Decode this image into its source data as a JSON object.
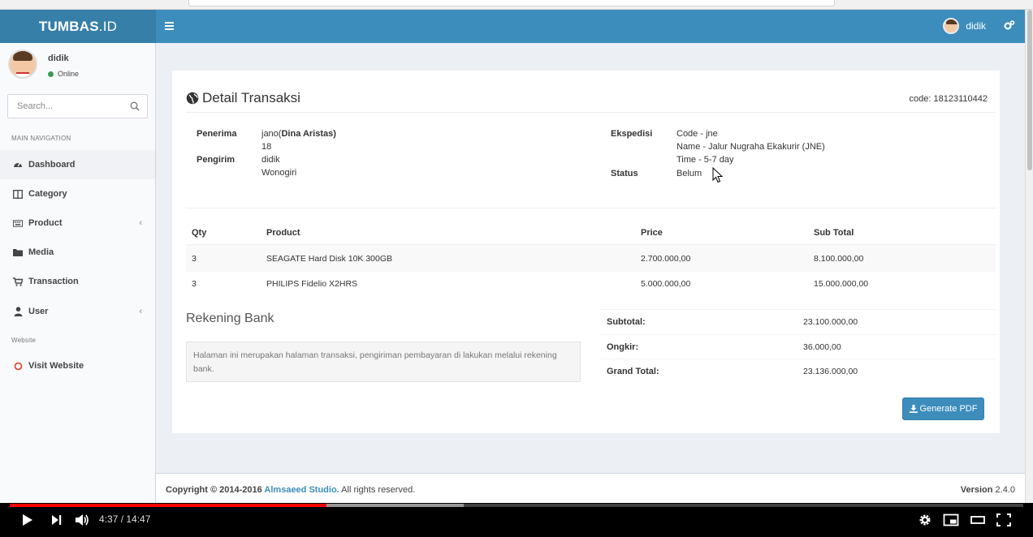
{
  "app": {
    "logo_bold": "TUMBAS",
    "logo_thin": ".ID",
    "header_user": "didik"
  },
  "sidebar": {
    "user_name": "didik",
    "user_status": "Online",
    "search_placeholder": "Search...",
    "main_nav_header": "MAIN NAVIGATION",
    "website_header": "Website",
    "items": [
      {
        "label": "Dashboard",
        "icon": "dashboard-icon",
        "active": true
      },
      {
        "label": "Category",
        "icon": "columns-icon"
      },
      {
        "label": "Product",
        "icon": "keyboard-icon",
        "has_submenu": true
      },
      {
        "label": "Media",
        "icon": "folder-icon"
      },
      {
        "label": "Transaction",
        "icon": "cart-icon"
      },
      {
        "label": "User",
        "icon": "user-icon",
        "has_submenu": true
      }
    ],
    "visit_website": "Visit Website"
  },
  "detail": {
    "title": "Detail Transaksi",
    "code": "code: 18123110442",
    "penerima_label": "Penerima",
    "penerima_name": "jano(",
    "penerima_bold": "Dina Aristas)",
    "penerima_line2": "18",
    "pengirim_label": "Pengirim",
    "pengirim_name": "didik",
    "pengirim_city": "Wonogiri",
    "ekspedisi_label": "Ekspedisi",
    "ekspedisi_code": "Code - jne",
    "ekspedisi_name": "Name - Jalur Nugraha Ekakurir (JNE)",
    "ekspedisi_time": "Time - 5-7 day",
    "status_label": "Status",
    "status_value": "Belum"
  },
  "table": {
    "headers": {
      "qty": "Qty",
      "product": "Product",
      "price": "Price",
      "subtotal": "Sub Total"
    },
    "rows": [
      {
        "qty": "3",
        "product": "SEAGATE Hard Disk 10K 300GB",
        "price": "2.700.000,00",
        "subtotal": "8.100.000,00"
      },
      {
        "qty": "3",
        "product": "PHILIPS Fidelio X2HRS",
        "price": "5.000.000,00",
        "subtotal": "15.000.000,00"
      }
    ]
  },
  "bank": {
    "title": "Rekening Bank",
    "note": "Halaman ini merupakan halaman transaksi, pengiriman pembayaran di lakukan melalui rekening bank."
  },
  "summary": {
    "subtotal_label": "Subtotal:",
    "subtotal_value": "23.100.000,00",
    "ongkir_label": "Ongkir:",
    "ongkir_value": "36.000,00",
    "grand_label": "Grand Total:",
    "grand_value": "23.136.000,00"
  },
  "buttons": {
    "generate_pdf": "Generate PDF"
  },
  "footer": {
    "copyright_prefix": "Copyright © 2014-2016 ",
    "studio": "Almsaeed Studio.",
    "rights": " All rights reserved.",
    "version_label": "Version",
    "version_value": " 2.4.0"
  },
  "player": {
    "time": "4:37 / 14:47",
    "progress_fraction": 0.3126
  },
  "colors": {
    "header": "#3c8dbc",
    "logo_bg": "#367fa9",
    "progress_played": "#ff0000"
  }
}
